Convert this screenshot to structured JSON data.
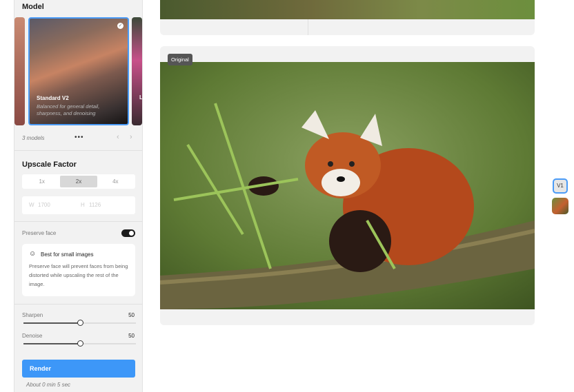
{
  "model": {
    "heading": "Model",
    "selected": {
      "name": "Standard V2",
      "description": "Balanced for general detail, sharpness, and denoising"
    },
    "next_card_initial": "L",
    "count_label": "3 models"
  },
  "upscale": {
    "heading": "Upscale Factor",
    "options": [
      "1x",
      "2x",
      "4x"
    ],
    "selected": "2x",
    "width_label": "W",
    "width": "1700",
    "height_label": "H",
    "height": "1126"
  },
  "preserve_face": {
    "label": "Preserve face",
    "enabled": true,
    "info_title": "Best for small images",
    "info_text": "Preserve face will prevent faces from being distorted while upscaling the rest of the image."
  },
  "sharpen": {
    "label": "Sharpen",
    "value": "50",
    "fraction": 0.5
  },
  "denoise": {
    "label": "Denoise",
    "value": "50",
    "fraction": 0.5
  },
  "render": {
    "label": "Render",
    "estimate": "About 0 min 5 sec"
  },
  "preview": {
    "badge": "Original"
  },
  "versions": {
    "current": "V1"
  },
  "colors": {
    "accent": "#3d97f8"
  }
}
